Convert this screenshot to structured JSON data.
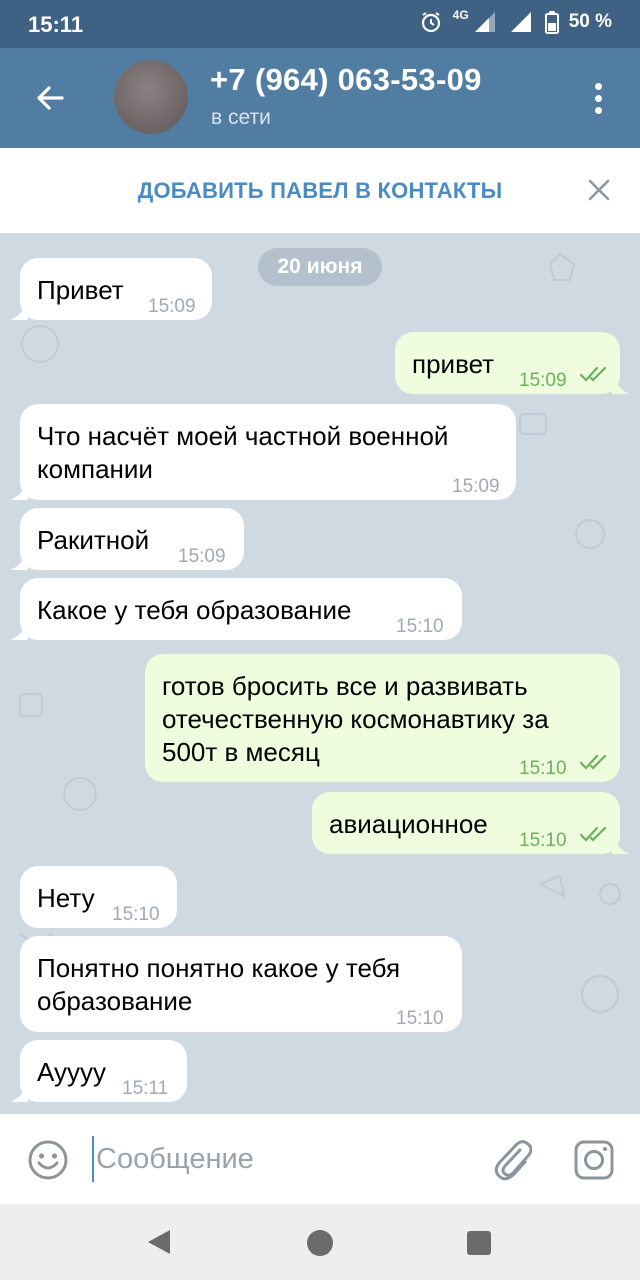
{
  "status_bar": {
    "time": "15:11",
    "network": "4G",
    "battery": "50 %"
  },
  "header": {
    "title": "+7 (964) 063-53-09",
    "subtitle": "в сети"
  },
  "add_contact_bar": {
    "label": "ДОБАВИТЬ ПАВЕЛ В КОНТАКТЫ"
  },
  "chat": {
    "date_chip": "20 июня",
    "messages": [
      {
        "direction": "in",
        "lines": [
          "Привет"
        ],
        "time": "15:09"
      },
      {
        "direction": "out",
        "lines": [
          "привет"
        ],
        "time": "15:09",
        "read": true
      },
      {
        "direction": "in",
        "lines": [
          "Что насчёт моей частной военной",
          "компании"
        ],
        "time": "15:09"
      },
      {
        "direction": "in",
        "lines": [
          "Ракитной"
        ],
        "time": "15:09"
      },
      {
        "direction": "in",
        "lines": [
          "Какое у тебя образование"
        ],
        "time": "15:10"
      },
      {
        "direction": "out",
        "lines": [
          "готов бросить все и развивать",
          "отечественную космонавтику за",
          "500т в месяц"
        ],
        "time": "15:10",
        "read": true
      },
      {
        "direction": "out",
        "lines": [
          "авиационное"
        ],
        "time": "15:10",
        "read": true
      },
      {
        "direction": "in",
        "lines": [
          "Нету"
        ],
        "time": "15:10"
      },
      {
        "direction": "in",
        "lines": [
          "Понятно понятно какое у тебя",
          "образование"
        ],
        "time": "15:10"
      },
      {
        "direction": "in",
        "lines": [
          "Ауууу"
        ],
        "time": "15:11"
      }
    ]
  },
  "composer": {
    "placeholder": "Сообщение"
  },
  "icons": {
    "back": "arrow-left-icon",
    "menu": "more-vertical-icon",
    "close": "close-icon",
    "emoji": "smile-icon",
    "attach": "paperclip-icon",
    "camera": "camera-icon",
    "read_receipt": "double-check-icon"
  },
  "colors": {
    "status_bar": "#3f6284",
    "app_bar": "#527da3",
    "accent": "#4a8bc2",
    "incoming_bubble": "#ffffff",
    "outgoing_bubble": "#effdde",
    "read_ticks": "#6bb25c",
    "chat_background": "#cfd9e1"
  }
}
